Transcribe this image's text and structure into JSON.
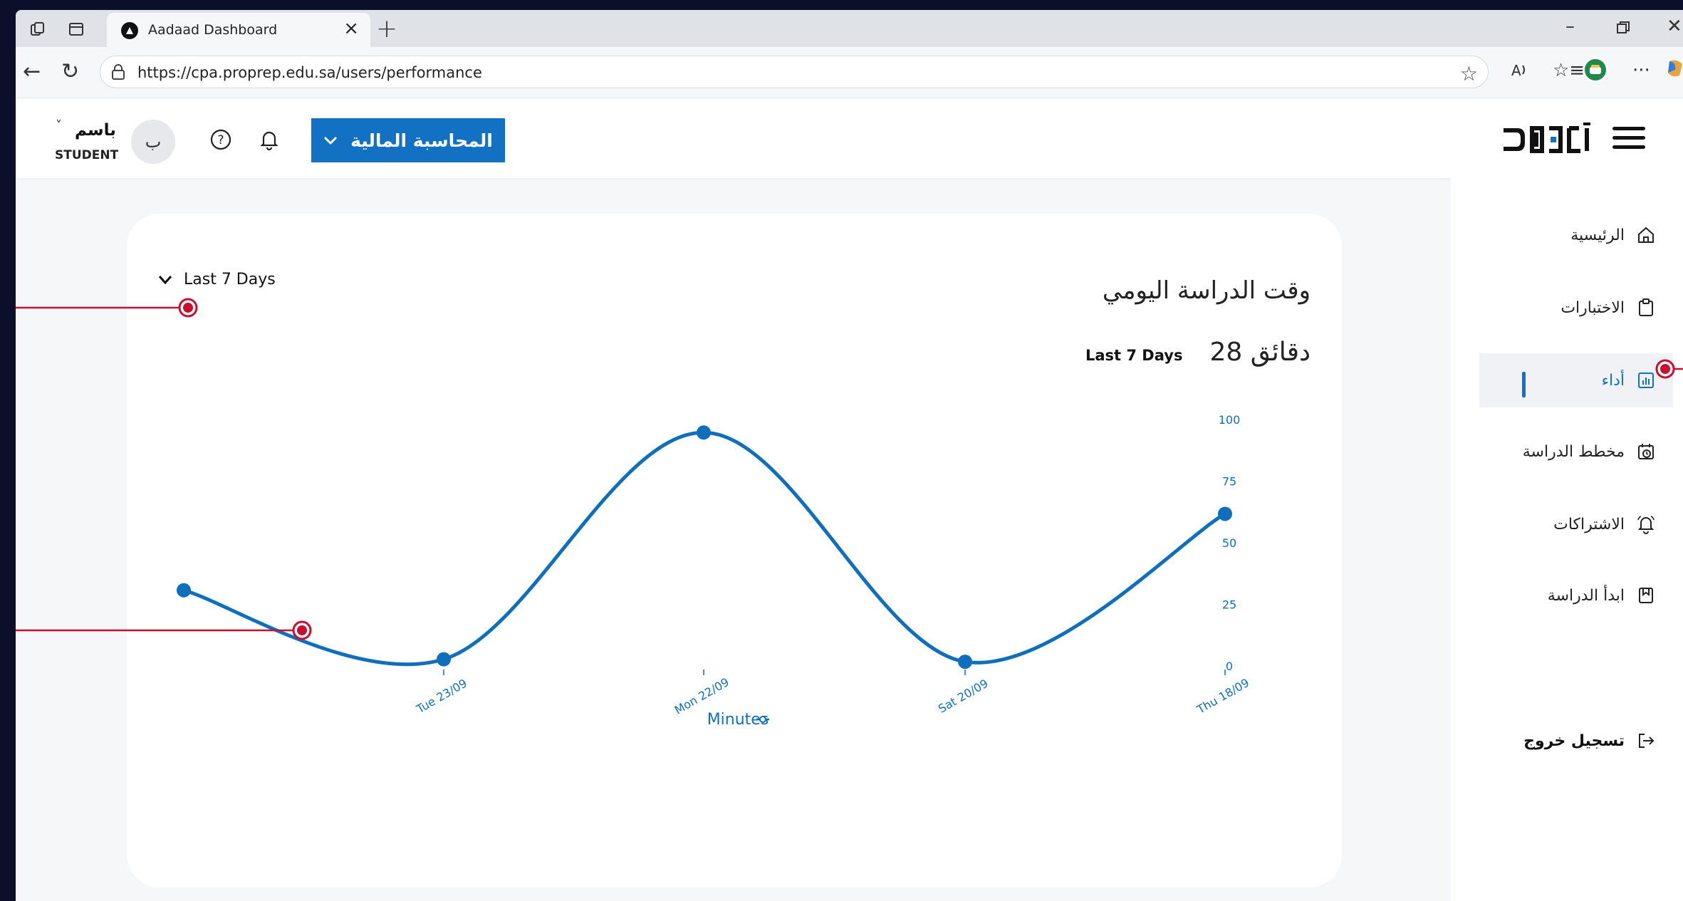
{
  "browser": {
    "tab_title": "Aadaad Dashboard",
    "url": "https://cpa.proprep.edu.sa/users/performance"
  },
  "header": {
    "user_name": "باسم",
    "user_role": "STUDENT",
    "avatar_initial": "ب",
    "course_label": "المحاسبة المالية"
  },
  "sidebar": {
    "items": [
      {
        "label": "الرئيسية",
        "icon": "home-icon"
      },
      {
        "label": "الاختبارات",
        "icon": "clipboard-icon"
      },
      {
        "label": "أداء",
        "icon": "bar-chart-icon"
      },
      {
        "label": "مخطط الدراسة",
        "icon": "calendar-clock-icon"
      },
      {
        "label": "الاشتراكات",
        "icon": "bell-icon"
      },
      {
        "label": "ابدأ الدراسة",
        "icon": "bookmark-icon"
      }
    ],
    "logout_label": "تسجيل خروج"
  },
  "card": {
    "title": "وقت الدراسة اليومي",
    "total": "28 دقائق",
    "period": "Last 7 Days",
    "filter_label": "Last 7 Days"
  },
  "chart_data": {
    "type": "line",
    "title": "وقت الدراسة اليومي",
    "xlabel": "",
    "ylabel": "",
    "categories": [
      "Thu 18/09",
      "Sat 20/09",
      "Mon 22/09",
      "Tue 23/09"
    ],
    "tick_labels": [
      "Tue 23/09",
      "Mon 22/09",
      "Sat 20/09",
      "Thu 18/09"
    ],
    "y_ticks": [
      "100",
      "75",
      "50",
      "25",
      "0"
    ],
    "ylim": [
      0,
      100
    ],
    "x_direction": "right-to-left",
    "points": [
      {
        "x": "Thu 18/09",
        "y": 62
      },
      {
        "x": "Sat 20/09",
        "y": 2
      },
      {
        "x": "Mon 22/09",
        "y": 95
      },
      {
        "x": "Tue 23/09",
        "y": 3
      },
      {
        "x": "",
        "y": 31
      }
    ],
    "series": [
      {
        "name": "Minutes",
        "values": [
          62,
          2,
          95,
          3,
          31
        ]
      }
    ],
    "legend": "bottom-center",
    "grid": false,
    "color": "#0f6fbd"
  },
  "colors": {
    "accent": "#1371c4",
    "annotation": "#c8102e"
  }
}
